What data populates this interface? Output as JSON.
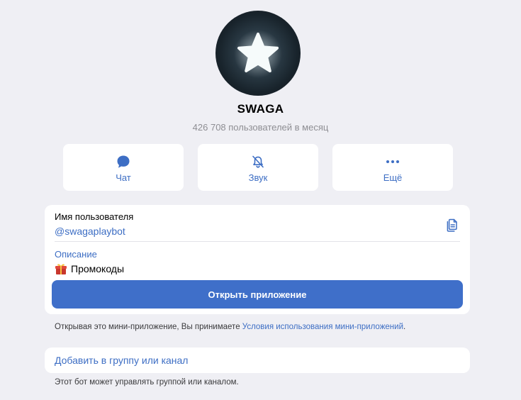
{
  "profile": {
    "name": "SWAGA",
    "subtitle": "426 708 пользователей в месяц",
    "avatar_icon": "star-icon"
  },
  "actions": [
    {
      "label": "Чат",
      "icon": "chat-icon"
    },
    {
      "label": "Звук",
      "icon": "bell-muted-icon"
    },
    {
      "label": "Ещё",
      "icon": "more-icon"
    }
  ],
  "info": {
    "username_label": "Имя пользователя",
    "username_value": "@swagaplaybot",
    "description_label": "Описание",
    "description_value": "Промокоды",
    "open_button_label": "Открыть приложение"
  },
  "terms": {
    "prefix": "Открывая это мини-приложение, Вы принимаете ",
    "link": "Условия использования мини-приложений",
    "suffix": "."
  },
  "group": {
    "add_label": "Добавить в группу или канал",
    "footnote": "Этот бот может управлять группой или каналом."
  },
  "colors": {
    "accent": "#3d6ec4",
    "button": "#3f6fc9",
    "background": "#efeff4"
  }
}
